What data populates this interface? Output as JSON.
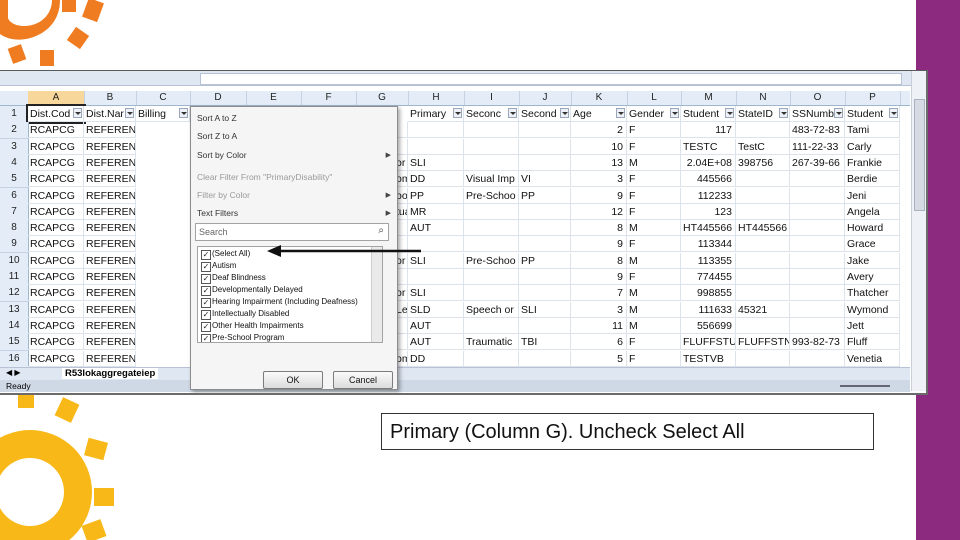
{
  "colors": {
    "purple": "#8b2a7e",
    "orange": "#f07c22",
    "yellow": "#f8b818"
  },
  "columns": [
    "A",
    "B",
    "C",
    "D",
    "E",
    "F",
    "G",
    "H",
    "I",
    "J",
    "K",
    "L",
    "M",
    "N",
    "O",
    "P"
  ],
  "header_row": [
    "Dist.Cod",
    "Dist.Nar",
    "Billing",
    "",
    "",
    "",
    "",
    "Primary",
    "Seconc",
    "Second",
    "Age",
    "Gender",
    "Student",
    "StateID",
    "SSNumb",
    "Student",
    "S"
  ],
  "rows": [
    {
      "n": "2",
      "a": "RCAPCG",
      "b": "REFERENCE SYST",
      "g": "",
      "h": "",
      "i": "",
      "j": "",
      "k": "2",
      "l": "F",
      "m": "117",
      "n2": "",
      "o": "483-72-83",
      "p": "Tami"
    },
    {
      "n": "3",
      "a": "RCAPCG",
      "b": "REFERENCE SYST",
      "g": "",
      "h": "",
      "i": "",
      "j": "",
      "k": "10",
      "l": "F",
      "m": "TESTC",
      "n2": "TestC",
      "o": "111-22-33",
      "p": "Carly"
    },
    {
      "n": "4",
      "a": "RCAPCG",
      "b": "REFERENCE SYST",
      "g": "or",
      "h": "SLI",
      "i": "",
      "j": "",
      "k": "13",
      "l": "M",
      "m": "2.04E+08",
      "n2": "398756",
      "o": "267-39-66",
      "p": "Frankie"
    },
    {
      "n": "5",
      "a": "RCAPCG",
      "b": "REFERENCE SYST",
      "g": "om",
      "h": "DD",
      "i": "Visual Imp",
      "j": "VI",
      "k": "3",
      "l": "F",
      "m": "445566",
      "n2": "",
      "o": "",
      "p": "Berdie"
    },
    {
      "n": "6",
      "a": "RCAPCG",
      "b": "REFERENCE SYST",
      "g": "oo",
      "h": "PP",
      "i": "Pre-Schoo",
      "j": "PP",
      "k": "9",
      "l": "F",
      "m": "112233",
      "n2": "",
      "o": "",
      "p": "Jeni"
    },
    {
      "n": "7",
      "a": "RCAPCG",
      "b": "REFERENCE SYST",
      "g": "tua",
      "h": "MR",
      "i": "",
      "j": "",
      "k": "12",
      "l": "F",
      "m": "123",
      "n2": "",
      "o": "",
      "p": "Angela"
    },
    {
      "n": "8",
      "a": "RCAPCG",
      "b": "REFERENCE SYST",
      "g": "",
      "h": "AUT",
      "i": "",
      "j": "",
      "k": "8",
      "l": "M",
      "m": "HT445566",
      "n2": "HT445566",
      "o": "",
      "p": "Howard"
    },
    {
      "n": "9",
      "a": "RCAPCG",
      "b": "REFERENCE SYST",
      "g": "",
      "h": "",
      "i": "",
      "j": "",
      "k": "9",
      "l": "F",
      "m": "113344",
      "n2": "",
      "o": "",
      "p": "Grace"
    },
    {
      "n": "10",
      "a": "RCAPCG",
      "b": "REFERENCE SYST",
      "g": "or",
      "h": "SLI",
      "i": "Pre-Schoo",
      "j": "PP",
      "k": "8",
      "l": "M",
      "m": "113355",
      "n2": "",
      "o": "",
      "p": "Jake"
    },
    {
      "n": "11",
      "a": "RCAPCG",
      "b": "REFERENCE SYST",
      "g": "",
      "h": "",
      "i": "",
      "j": "",
      "k": "9",
      "l": "F",
      "m": "774455",
      "n2": "",
      "o": "",
      "p": "Avery"
    },
    {
      "n": "12",
      "a": "RCAPCG",
      "b": "REFERENCE SYST",
      "g": "or",
      "h": "SLI",
      "i": "",
      "j": "",
      "k": "7",
      "l": "M",
      "m": "998855",
      "n2": "",
      "o": "",
      "p": "Thatcher"
    },
    {
      "n": "13",
      "a": "RCAPCG",
      "b": "REFERENCE SYST",
      "g": "Le",
      "h": "SLD",
      "i": "Speech or",
      "j": "SLI",
      "k": "3",
      "l": "M",
      "m": "111633",
      "n2": "45321",
      "o": "",
      "p": "Wymond"
    },
    {
      "n": "14",
      "a": "RCAPCG",
      "b": "REFERENCE SYST",
      "g": "",
      "h": "AUT",
      "i": "",
      "j": "",
      "k": "11",
      "l": "M",
      "m": "556699",
      "n2": "",
      "o": "",
      "p": "Jett"
    },
    {
      "n": "15",
      "a": "RCAPCG",
      "b": "REFERENCE SYST",
      "g": "",
      "h": "AUT",
      "i": "Traumatic",
      "j": "TBI",
      "k": "6",
      "l": "F",
      "m": "FLUFFSTUFF",
      "n2": "FLUFFSTN",
      "o": "993-82-73",
      "p": "Fluff"
    },
    {
      "n": "16",
      "a": "RCAPCG",
      "b": "REFERENCE SYST",
      "g": "om",
      "h": "DD",
      "i": "",
      "j": "",
      "k": "5",
      "l": "F",
      "m": "TESTVB",
      "n2": "",
      "o": "",
      "p": "Venetia"
    }
  ],
  "row1_label": "1",
  "sheet_tab": "R53lokaggregateiep",
  "status": "Ready",
  "filter_menu": {
    "sort_az": "Sort A to Z",
    "sort_za": "Sort Z to A",
    "sort_color": "Sort by Color",
    "clear_filter": "Clear Filter From \"PrimaryDisability\"",
    "filter_color": "Filter by Color",
    "text_filters": "Text Filters",
    "search_placeholder": "Search",
    "items": [
      {
        "label": "(Select All)",
        "checked": true
      },
      {
        "label": "Autism",
        "checked": true
      },
      {
        "label": "Deaf Blindness",
        "checked": true
      },
      {
        "label": "Developmentally Delayed",
        "checked": true
      },
      {
        "label": "Hearing Impairment (Including Deafness)",
        "checked": true
      },
      {
        "label": "Intellectually Disabled",
        "checked": true
      },
      {
        "label": "Other Health Impairments",
        "checked": true
      },
      {
        "label": "Pre-School Program",
        "checked": true
      }
    ],
    "ok": "OK",
    "cancel": "Cancel"
  },
  "caption": "Primary (Column G). Uncheck Select All"
}
